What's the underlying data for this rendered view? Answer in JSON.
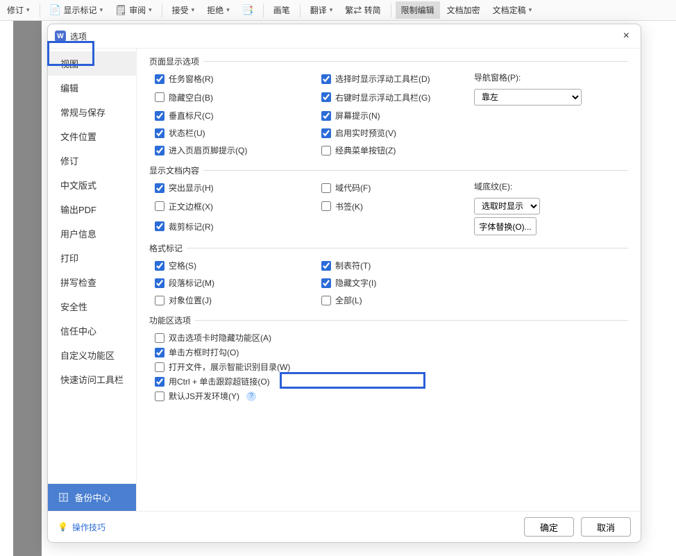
{
  "ribbon": {
    "revision": "修订",
    "show_marks": "显示标记",
    "review": "审阅",
    "accept": "接受",
    "reject": "拒绝",
    "pen": "画笔",
    "translate": "翻译",
    "trad_conv": "繁⇄ 转简",
    "restrict_edit": "限制编辑",
    "doc_encrypt": "文档加密",
    "doc_draft": "文档定稿"
  },
  "dialog": {
    "title": "选项",
    "close": "×"
  },
  "sidebar": {
    "items": [
      "视图",
      "编辑",
      "常规与保存",
      "文件位置",
      "修订",
      "中文版式",
      "输出PDF",
      "用户信息",
      "打印",
      "拼写检查",
      "安全性",
      "信任中心",
      "自定义功能区",
      "快速访问工具栏"
    ],
    "backup": "备份中心"
  },
  "sections": {
    "page_display": {
      "title": "页面显示选项",
      "task_pane": "任务窗格(R)",
      "hide_blank": "隐藏空白(B)",
      "vertical_ruler": "垂直标尺(C)",
      "status_bar": "状态栏(U)",
      "enter_header": "进入页眉页脚提示(Q)",
      "select_float": "选择时显示浮动工具栏(D)",
      "rclick_float": "右键时显示浮动工具栏(G)",
      "screen_tips": "屏幕提示(N)",
      "live_preview": "启用实时预览(V)",
      "classic_menu": "经典菜单按钮(Z)",
      "nav_pane": "导航窗格(P):",
      "nav_pane_value": "靠左"
    },
    "doc_content": {
      "title": "显示文档内容",
      "highlight": "突出显示(H)",
      "text_border": "正文边框(X)",
      "crop_marks": "裁剪标记(R)",
      "field_codes": "域代码(F)",
      "bookmarks": "书签(K)",
      "field_shading": "域底纹(E):",
      "field_shading_value": "选取时显示",
      "font_sub": "字体替换(O)..."
    },
    "format_marks": {
      "title": "格式标记",
      "spaces": "空格(S)",
      "para_marks": "段落标记(M)",
      "obj_pos": "对象位置(J)",
      "tabs": "制表符(T)",
      "hidden_text": "隐藏文字(I)",
      "all": "全部(L)"
    },
    "ribbon_opts": {
      "title": "功能区选项",
      "dblclick_hide": "双击选项卡时隐藏功能区(A)",
      "click_checkbox": "单击方框时打勾(O)",
      "open_smart_toc": "打开文件，展示智能识别目录(W)",
      "ctrl_click_link": "用Ctrl + 单击跟踪超链接(O)",
      "default_js_env": "默认JS开发环境(Y)"
    }
  },
  "footer": {
    "tips": "操作技巧",
    "ok": "确定",
    "cancel": "取消"
  }
}
